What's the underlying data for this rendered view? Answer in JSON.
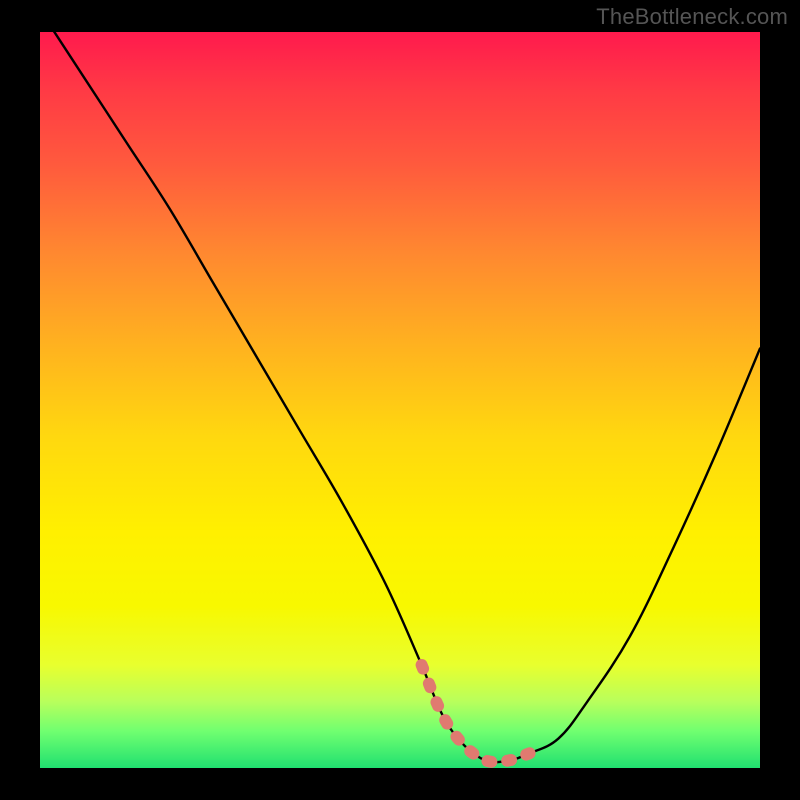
{
  "watermark": "TheBottleneck.com",
  "chart_data": {
    "type": "line",
    "title": "",
    "xlabel": "",
    "ylabel": "",
    "xlim": [
      0,
      100
    ],
    "ylim": [
      0,
      100
    ],
    "series": [
      {
        "name": "bottleneck-curve",
        "x": [
          0,
          6,
          12,
          18,
          24,
          30,
          36,
          42,
          48,
          53,
          56,
          59,
          62,
          65,
          68,
          72,
          76,
          82,
          88,
          94,
          100
        ],
        "values": [
          103,
          94,
          85,
          76,
          66,
          56,
          46,
          36,
          25,
          14,
          7,
          3,
          1,
          1,
          2,
          4,
          9,
          18,
          30,
          43,
          57
        ]
      }
    ],
    "highlight": {
      "name": "highlight-region",
      "color": "#e07a70",
      "x": [
        53,
        56,
        59,
        62,
        65,
        68
      ],
      "values": [
        14,
        7,
        3,
        1,
        1,
        2
      ]
    },
    "background_gradient": {
      "top": "#ff1a4d",
      "mid": "#ffd80f",
      "bottom": "#20e070"
    }
  }
}
